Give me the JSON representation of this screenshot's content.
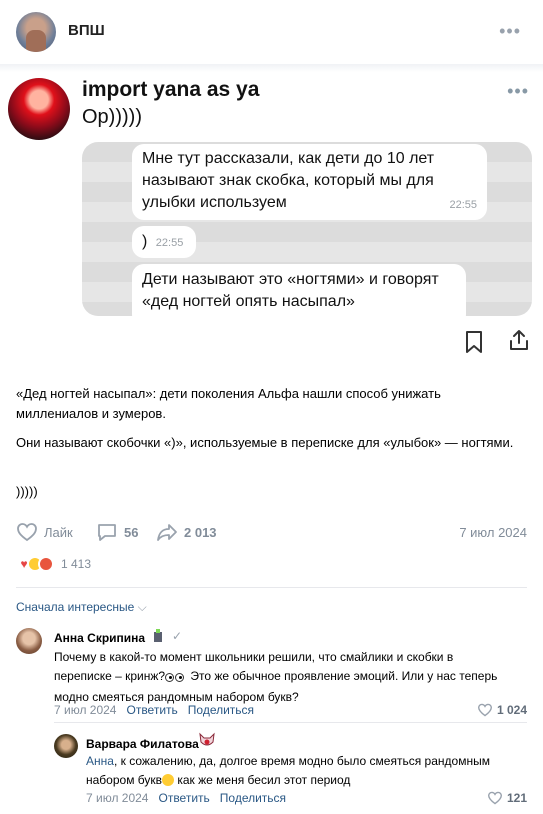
{
  "header": {
    "title": "ВПШ",
    "more_icon": "more-horizontal-icon"
  },
  "tweet": {
    "author": "import yana as ya",
    "text": "Ор)))))",
    "chat": {
      "msg1": "Мне тут рассказали, как дети до 10 лет называют знак скобка, который мы для улыбки используем",
      "msg1_time": "22:55",
      "msg2": ")",
      "msg2_time": "22:55",
      "msg3": "Дети называют это «ногтями» и говорят «дед ногтей опять насыпал»"
    }
  },
  "post": {
    "paragraph1": "«Дед ногтей насыпал»: дети поколения Альфа нашли способ унижать миллениалов и зумеров.",
    "paragraph2": "Они называют скобочки «)», используемые в переписке для «улыбок» — ногтями.",
    "paragraph3": ")))))"
  },
  "actions": {
    "like_label": "Лайк",
    "comments_count": "56",
    "shares_count": "2 013",
    "date": "7 июл 2024"
  },
  "reactions": {
    "count": "1 413",
    "colors": {
      "heart": "#e64646",
      "laugh": "#ffcc33",
      "angry": "#e8553e"
    }
  },
  "comments_sort": "Сначала интересные",
  "comments": [
    {
      "author": "Анна Скрипина",
      "text_before_emoji": "Почему в какой-то момент школьники решили, что смайлики и скобки в переписке – кринж?",
      "text_after_emoji": " Это же обычное проявление эмоций. Или у нас теперь модно смеяться рандомным набором букв?",
      "date": "7 июл 2024",
      "reply_label": "Ответить",
      "share_label": "Поделиться",
      "likes": "1 024"
    },
    {
      "author": "Варвара Филатова",
      "mention": "Анна",
      "text_before_emoji": ", к сожалению, да, долгое время модно было смеяться рандомным набором букв",
      "text_after_emoji": " как же меня бесил этот период",
      "date": "7 июл 2024",
      "reply_label": "Ответить",
      "share_label": "Поделиться",
      "likes": "121"
    }
  ],
  "colors": {
    "link": "#2a5885",
    "muted": "#818c99"
  }
}
